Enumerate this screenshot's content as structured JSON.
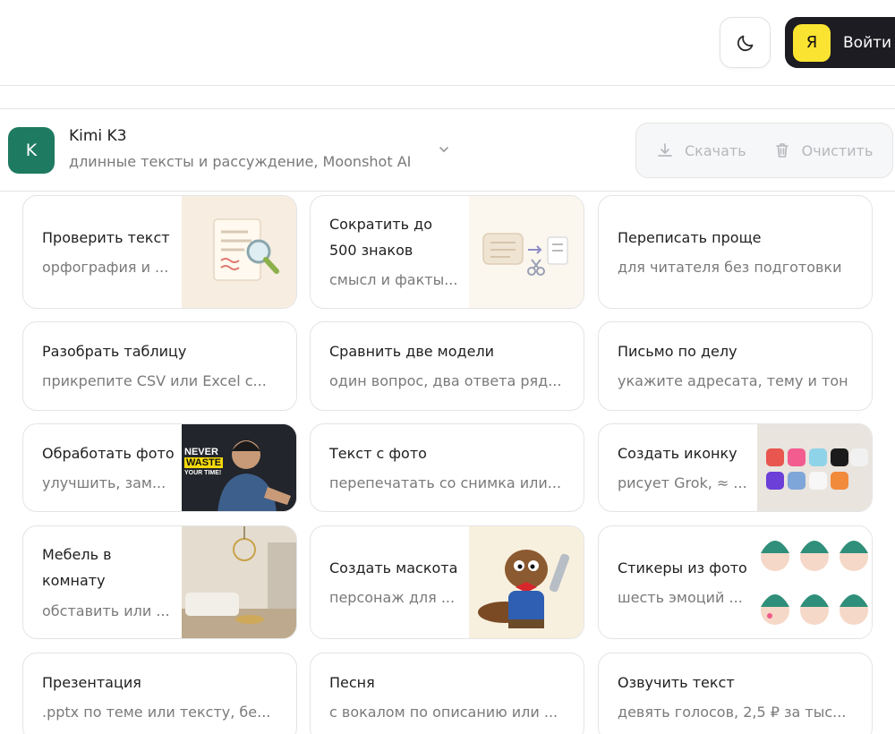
{
  "header": {
    "theme_toggle_icon": "moon-icon",
    "login": {
      "badge": "Я",
      "label": "Войти"
    }
  },
  "model": {
    "avatar_letter": "K",
    "name": "Kimi K3",
    "description": "длинные тексты и рассуждение, Moonshot AI",
    "download_label": "Скачать",
    "clear_label": "Очистить"
  },
  "cards": [
    {
      "title": "Проверить текст",
      "subtitle": "орфография и ..."
    },
    {
      "title": "Сократить до 500 знаков",
      "subtitle": "смысл и факты..."
    },
    {
      "title": "Переписать проще",
      "subtitle": "для читателя без подготовки"
    },
    {
      "title": "Разобрать таблицу",
      "subtitle": "прикрепите CSV или Excel с..."
    },
    {
      "title": "Сравнить две модели",
      "subtitle": "один вопрос, два ответа ряд..."
    },
    {
      "title": "Письмо по делу",
      "subtitle": "укажите адресата, тему и тон"
    },
    {
      "title": "Обработать фото",
      "subtitle": "улучшить, зам...",
      "thumb_text": [
        "NEVER",
        "WASTE",
        "YOUR TIME!"
      ]
    },
    {
      "title": "Текст с фото",
      "subtitle": "перепечатать со снимка или..."
    },
    {
      "title": "Создать иконку",
      "subtitle": "рисует Grok, ≈ ..."
    },
    {
      "title": "Мебель в комнату",
      "subtitle": "обставить или ..."
    },
    {
      "title": "Создать маскота",
      "subtitle": "персонаж для ..."
    },
    {
      "title": "Стикеры из фото",
      "subtitle": "шесть эмоций ..."
    },
    {
      "title": "Презентация",
      "subtitle": ".pptx по теме или тексту, бе..."
    },
    {
      "title": "Песня",
      "subtitle": "с вокалом по описанию или ..."
    },
    {
      "title": "Озвучить текст",
      "subtitle": "девять голосов, 2,5 ₽ за тыс..."
    }
  ]
}
